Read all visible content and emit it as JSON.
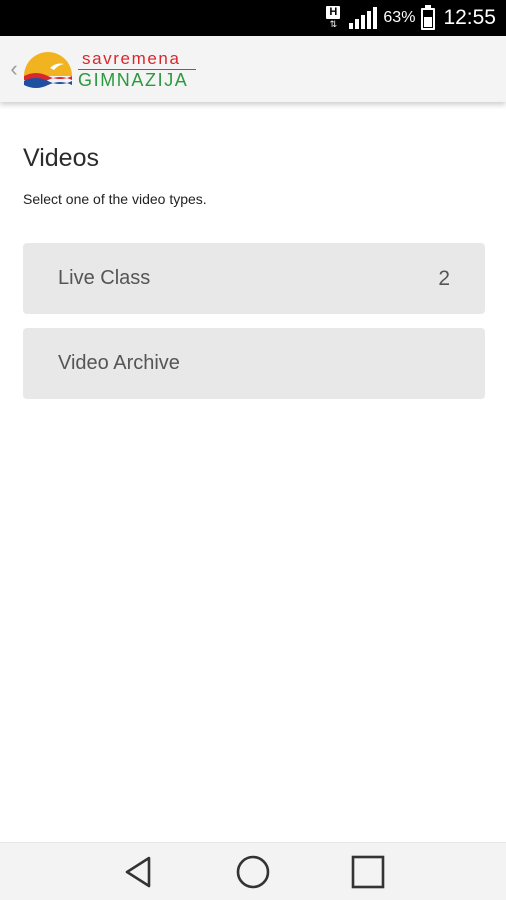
{
  "status_bar": {
    "network_type": "H",
    "network_arrows": "⇅",
    "battery_percent": "63%",
    "battery_level": 0.63,
    "time": "12:55"
  },
  "app_bar": {
    "back_icon": "chevron-left-icon",
    "logo_top": "savremena",
    "logo_bottom": "GIMNAZIJA"
  },
  "main": {
    "title": "Videos",
    "subtitle": "Select one of the video types.",
    "options": [
      {
        "label": "Live Class",
        "count": "2"
      },
      {
        "label": "Video Archive",
        "count": ""
      }
    ]
  },
  "nav_bar": {
    "back": "back-triangle-icon",
    "home": "home-circle-icon",
    "recents": "recents-square-icon"
  },
  "colors": {
    "status_bar_bg": "#000000",
    "app_bar_bg": "#f4f4f4",
    "option_bg": "#e8e8e8",
    "logo_red": "#d8282e",
    "logo_green": "#2a9a3e",
    "sun_yellow": "#f2b320",
    "wave_blue": "#1f4fa0"
  }
}
